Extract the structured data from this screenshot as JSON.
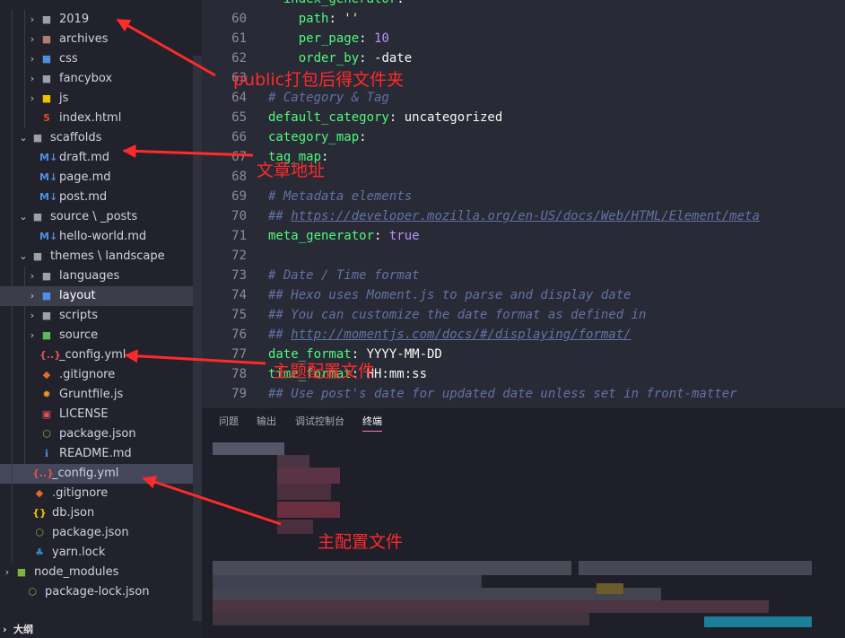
{
  "explorer": {
    "items": [
      {
        "label": "2019",
        "kind": "folder",
        "chev": "›",
        "icon": "■",
        "iconColor": "#9aa0ad",
        "depth": 1
      },
      {
        "label": "archives",
        "kind": "folder",
        "chev": "›",
        "icon": "■",
        "iconColor": "#b07d6e",
        "depth": 1
      },
      {
        "label": "css",
        "kind": "folder",
        "chev": "›",
        "icon": "■",
        "iconColor": "#4f8fe0",
        "depth": 1
      },
      {
        "label": "fancybox",
        "kind": "folder",
        "chev": "›",
        "icon": "■",
        "iconColor": "#9aa0ad",
        "depth": 1
      },
      {
        "label": "js",
        "kind": "folder",
        "chev": "›",
        "icon": "■",
        "iconColor": "#f0c000",
        "depth": 1
      },
      {
        "label": "index.html",
        "kind": "file",
        "chev": "",
        "icon": "5",
        "iconColor": "#e34c26",
        "depth": 2
      },
      {
        "label": "scaffolds",
        "kind": "folder-open",
        "chev": "⌄",
        "icon": "■",
        "iconColor": "#9aa0ad",
        "depth": 0
      },
      {
        "label": "draft.md",
        "kind": "file",
        "chev": "",
        "icon": "M↓",
        "iconColor": "#4f8fe0",
        "depth": 1
      },
      {
        "label": "page.md",
        "kind": "file",
        "chev": "",
        "icon": "M↓",
        "iconColor": "#4f8fe0",
        "depth": 1
      },
      {
        "label": "post.md",
        "kind": "file",
        "chev": "",
        "icon": "M↓",
        "iconColor": "#4f8fe0",
        "depth": 1
      },
      {
        "label": "source \\ _posts",
        "kind": "folder-open",
        "chev": "⌄",
        "icon": "■",
        "iconColor": "#9aa0ad",
        "depth": 0
      },
      {
        "label": "hello-world.md",
        "kind": "file",
        "chev": "",
        "icon": "M↓",
        "iconColor": "#4f8fe0",
        "depth": 1
      },
      {
        "label": "themes \\ landscape",
        "kind": "folder-open",
        "chev": "⌄",
        "icon": "■",
        "iconColor": "#9aa0ad",
        "depth": 0
      },
      {
        "label": "languages",
        "kind": "folder",
        "chev": "›",
        "icon": "■",
        "iconColor": "#9aa0ad",
        "depth": 1
      },
      {
        "label": "layout",
        "kind": "folder",
        "chev": "›",
        "icon": "■",
        "iconColor": "#4f8fe0",
        "depth": 1,
        "highlight": true
      },
      {
        "label": "scripts",
        "kind": "folder",
        "chev": "›",
        "icon": "■",
        "iconColor": "#9aa0ad",
        "depth": 1
      },
      {
        "label": "source",
        "kind": "folder",
        "chev": "›",
        "icon": "■",
        "iconColor": "#5cb85c",
        "depth": 1
      },
      {
        "label": "_config.yml",
        "kind": "file",
        "chev": "",
        "icon": "{..}",
        "iconColor": "#e05252",
        "depth": 2
      },
      {
        "label": ".gitignore",
        "kind": "file",
        "chev": "",
        "icon": "◆",
        "iconColor": "#e86a2a",
        "depth": 2
      },
      {
        "label": "Gruntfile.js",
        "kind": "file",
        "chev": "",
        "icon": "✹",
        "iconColor": "#e49b24",
        "depth": 2
      },
      {
        "label": "LICENSE",
        "kind": "file",
        "chev": "",
        "icon": "▣",
        "iconColor": "#e05252",
        "depth": 2
      },
      {
        "label": "package.json",
        "kind": "file",
        "chev": "",
        "icon": "⬡",
        "iconColor": "#7cb342",
        "depth": 2
      },
      {
        "label": "README.md",
        "kind": "file",
        "chev": "",
        "icon": "ℹ",
        "iconColor": "#4f8fe0",
        "depth": 2
      },
      {
        "label": "_config.yml",
        "kind": "file",
        "chev": "",
        "icon": "{..}",
        "iconColor": "#e05252",
        "depth": 0,
        "selected": true
      },
      {
        "label": ".gitignore",
        "kind": "file",
        "chev": "",
        "icon": "◆",
        "iconColor": "#e86a2a",
        "depth": 0
      },
      {
        "label": "db.json",
        "kind": "file",
        "chev": "",
        "icon": "{}",
        "iconColor": "#f0c000",
        "depth": 0
      },
      {
        "label": "package.json",
        "kind": "file",
        "chev": "",
        "icon": "⬡",
        "iconColor": "#7cb342",
        "depth": 0
      },
      {
        "label": "yarn.lock",
        "kind": "file",
        "chev": "",
        "icon": "♣",
        "iconColor": "#2c8ebb",
        "depth": 0
      },
      {
        "label": "node_modules",
        "kind": "folder",
        "chev": "›",
        "icon": "■",
        "iconColor": "#7cb342",
        "depth": -1
      },
      {
        "label": "package-lock.json",
        "kind": "file",
        "chev": "",
        "icon": "⬡",
        "iconColor": "#7cb342",
        "depth": -2
      }
    ],
    "outline_label": "大纲",
    "outline_chev": "›"
  },
  "editor": {
    "lines": [
      {
        "num": "",
        "html": "  <span class='k'>index_generator</span>:"
      },
      {
        "num": "60",
        "html": "    <span class='k'>path</span>: <span class='s'>''</span>"
      },
      {
        "num": "61",
        "html": "    <span class='k'>per_page</span>: <span class='n'>10</span>"
      },
      {
        "num": "62",
        "html": "    <span class='k'>order_by</span>: -date"
      },
      {
        "num": "63",
        "html": ""
      },
      {
        "num": "64",
        "html": "<span class='c'># Category &amp; Tag</span>"
      },
      {
        "num": "65",
        "html": "<span class='k'>default_category</span>: uncategorized"
      },
      {
        "num": "66",
        "html": "<span class='k'>category_map</span>:"
      },
      {
        "num": "67",
        "html": "<span class='k'>tag_map</span>:"
      },
      {
        "num": "68",
        "html": ""
      },
      {
        "num": "69",
        "html": "<span class='c'># Metadata elements</span>"
      },
      {
        "num": "70",
        "html": "<span class='c'>## </span><span class='u'>https://developer.mozilla.org/en-US/docs/Web/HTML/Element/meta</span>"
      },
      {
        "num": "71",
        "html": "<span class='k'>meta_generator</span>: <span class='n'>true</span>"
      },
      {
        "num": "72",
        "html": ""
      },
      {
        "num": "73",
        "html": "<span class='c'># Date / Time format</span>"
      },
      {
        "num": "74",
        "html": "<span class='c'>## Hexo uses Moment.js to parse and display date</span>"
      },
      {
        "num": "75",
        "html": "<span class='c'>## You can customize the date format as defined in</span>"
      },
      {
        "num": "76",
        "html": "<span class='c'>## </span><span class='u'>http://momentjs.com/docs/#/displaying/format/</span>"
      },
      {
        "num": "77",
        "html": "<span class='k'>date_format</span>: YYYY-MM-DD"
      },
      {
        "num": "78",
        "html": "<span class='k'>time_format</span>: HH:mm:ss"
      },
      {
        "num": "79",
        "html": "<span class='c'>## Use post's date for updated date unless set in front-matter</span>"
      }
    ]
  },
  "panel": {
    "tabs": [
      "问题",
      "输出",
      "调试控制台",
      "终端"
    ],
    "active_tab": 3
  },
  "annotations": {
    "public_folder": "public打包后得文件夹",
    "scaffolds_note": "文章地址",
    "theme_config": "主题配置文件",
    "main_config": "主配置文件"
  },
  "colors": {
    "annotation": "#ff2a2a",
    "sidebar_bg": "#21222c",
    "editor_bg": "#282a36"
  }
}
